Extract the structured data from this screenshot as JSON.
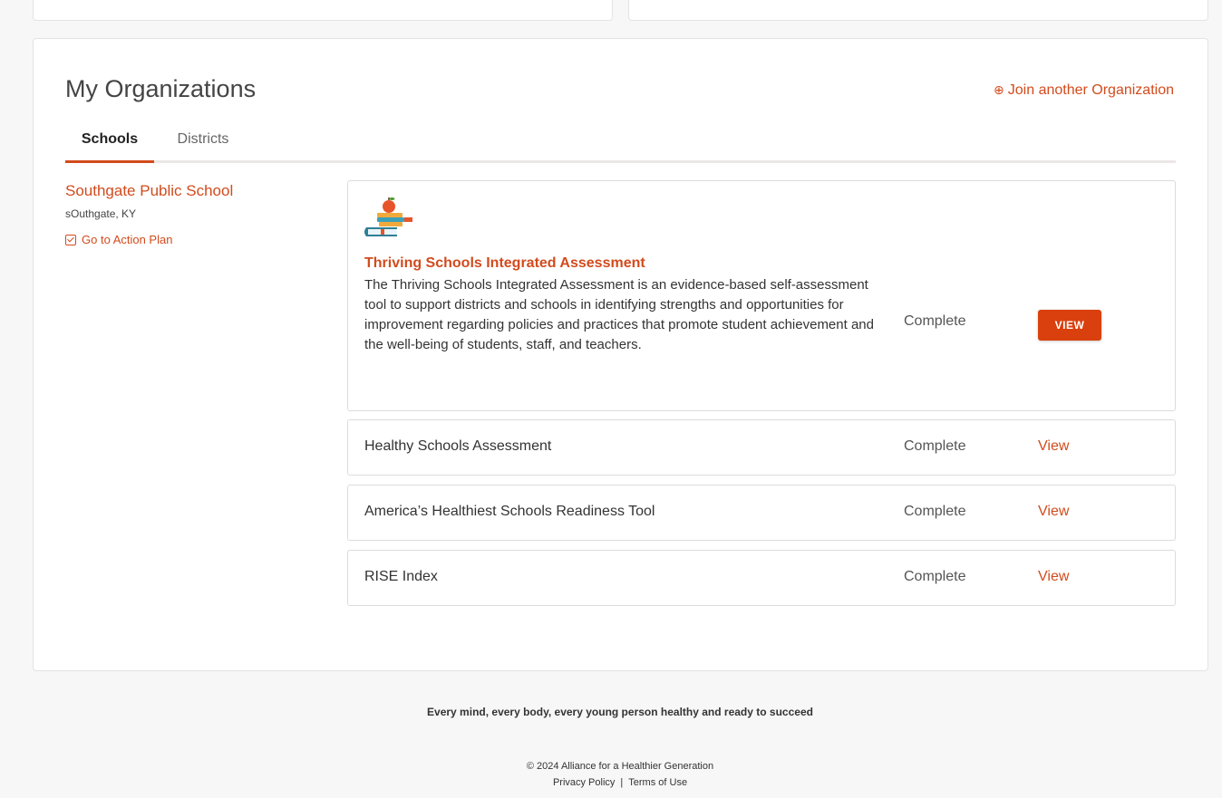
{
  "organizations": {
    "title": "My Organizations",
    "join_label": "Join another Organization",
    "tabs": [
      {
        "label": "Schools",
        "active": true
      },
      {
        "label": "Districts",
        "active": false
      }
    ]
  },
  "school": {
    "name": "Southgate Public School",
    "location": "sOuthgate, KY",
    "action_plan_label": "Go to Action Plan"
  },
  "assessments": [
    {
      "name": "Thriving Schools Integrated Assessment",
      "description": "The Thriving Schools Integrated Assessment is an evidence-based self-assessment tool to support districts and schools in identifying strengths and opportunities for improvement regarding policies and practices that promote student achievement and the well-being of students, staff, and teachers.",
      "status": "Complete",
      "action": "VIEW"
    },
    {
      "name": "Healthy Schools Assessment",
      "status": "Complete",
      "action": "View"
    },
    {
      "name": "America’s Healthiest Schools Readiness Tool",
      "status": "Complete",
      "action": "View"
    },
    {
      "name": "RISE Index",
      "status": "Complete",
      "action": "View"
    }
  ],
  "footer": {
    "tagline": "Every mind, every body, every young person healthy and ready to succeed",
    "copyright": "© 2024 Alliance for a Healthier Generation",
    "privacy": "Privacy Policy",
    "separator": "|",
    "terms": "Terms of Use"
  },
  "colors": {
    "accent": "#d24b1d",
    "button": "#d9400d",
    "background": "#f7f7f7"
  }
}
